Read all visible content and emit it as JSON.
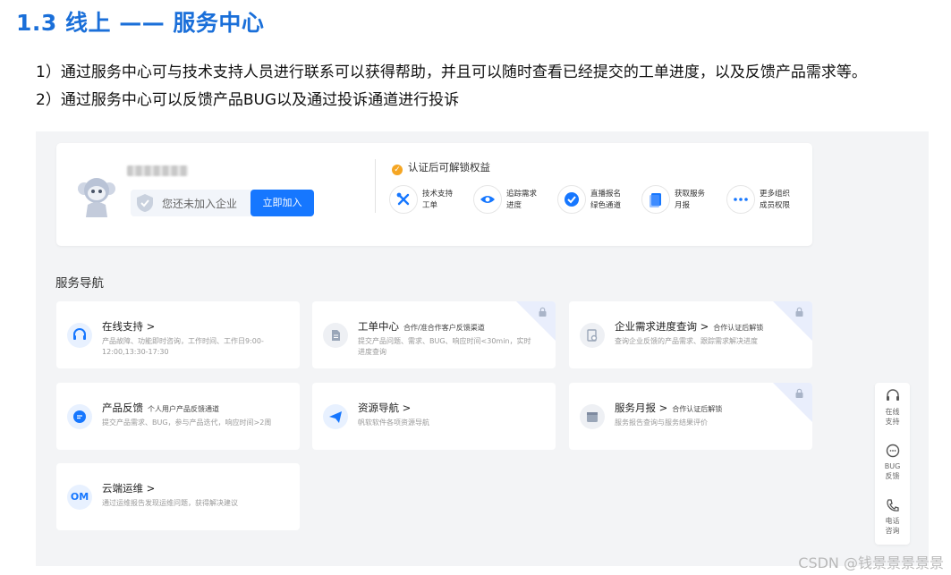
{
  "heading": "1.3 线上 —— 服务中心",
  "bullets": [
    "1）通过服务中心可与技术支持人员进行联系可以获得帮助，并且可以随时查看已经提交的工单进度，以及反馈产品需求等。",
    "2）通过服务中心可以反馈产品BUG以及通过投诉通道进行投诉"
  ],
  "profile": {
    "enterprise_text": "您还未加入企业",
    "join_button": "立即加入",
    "benefits_title": "认证后可解锁权益",
    "benefits": [
      {
        "line1": "技术支持",
        "line2": "工单",
        "icon": "tools-icon"
      },
      {
        "line1": "追踪需求",
        "line2": "进度",
        "icon": "eye-icon"
      },
      {
        "line1": "直播报名",
        "line2": "绿色通道",
        "icon": "check-icon"
      },
      {
        "line1": "获取服务",
        "line2": "月报",
        "icon": "report-icon"
      },
      {
        "line1": "更多组织",
        "line2": "成员权限",
        "icon": "more-icon"
      }
    ]
  },
  "nav_title": "服务导航",
  "cards": [
    {
      "title": "在线支持 >",
      "tag": "",
      "desc": "产品故障、功能即时咨询，工作时间、工作日9:00-12:00,13:30-17:30",
      "icon": "headset-icon",
      "locked": false
    },
    {
      "title": "工单中心",
      "tag": "合作/准合作客户反馈渠道",
      "desc": "提交产品问题、需求、BUG、响应时间<30min，实时进度查询",
      "icon": "document-icon",
      "locked": true
    },
    {
      "title": "企业需求进度查询 >",
      "tag": "合作认证后解锁",
      "desc": "查询企业反馈的产品需求、跟踪需求解决进度",
      "icon": "search-doc-icon",
      "locked": true
    },
    {
      "title": "产品反馈",
      "tag": "个人用户产品反馈通道",
      "desc": "提交产品需求、BUG，参与产品迭代，响应时间>2周",
      "icon": "chat-icon",
      "locked": false
    },
    {
      "title": "资源导航 >",
      "tag": "",
      "desc": "帆软软件各项资源导航",
      "icon": "paper-plane-icon",
      "locked": false
    },
    {
      "title": "服务月报 >",
      "tag": "合作认证后解锁",
      "desc": "服务报告查询与服务结果评价",
      "icon": "calendar-icon",
      "locked": true
    },
    {
      "title": "云端运维 >",
      "tag": "",
      "desc": "通过运维报告发现运维问题，获得解决建议",
      "icon": "om-icon",
      "locked": false
    }
  ],
  "om_label": "OM",
  "float_bar": [
    {
      "line1": "在线",
      "line2": "支持",
      "icon": "headset-icon"
    },
    {
      "line1": "BUG",
      "line2": "反馈",
      "icon": "chat-bubble-icon"
    },
    {
      "line1": "电话",
      "line2": "咨询",
      "icon": "phone-icon"
    }
  ],
  "watermark": "CSDN @钱景景景景景",
  "colors": {
    "heading": "#1a6fd9",
    "primary": "#1677ff",
    "icon_bg": "#e8f1ff",
    "panel_bg": "#f3f4f6"
  }
}
